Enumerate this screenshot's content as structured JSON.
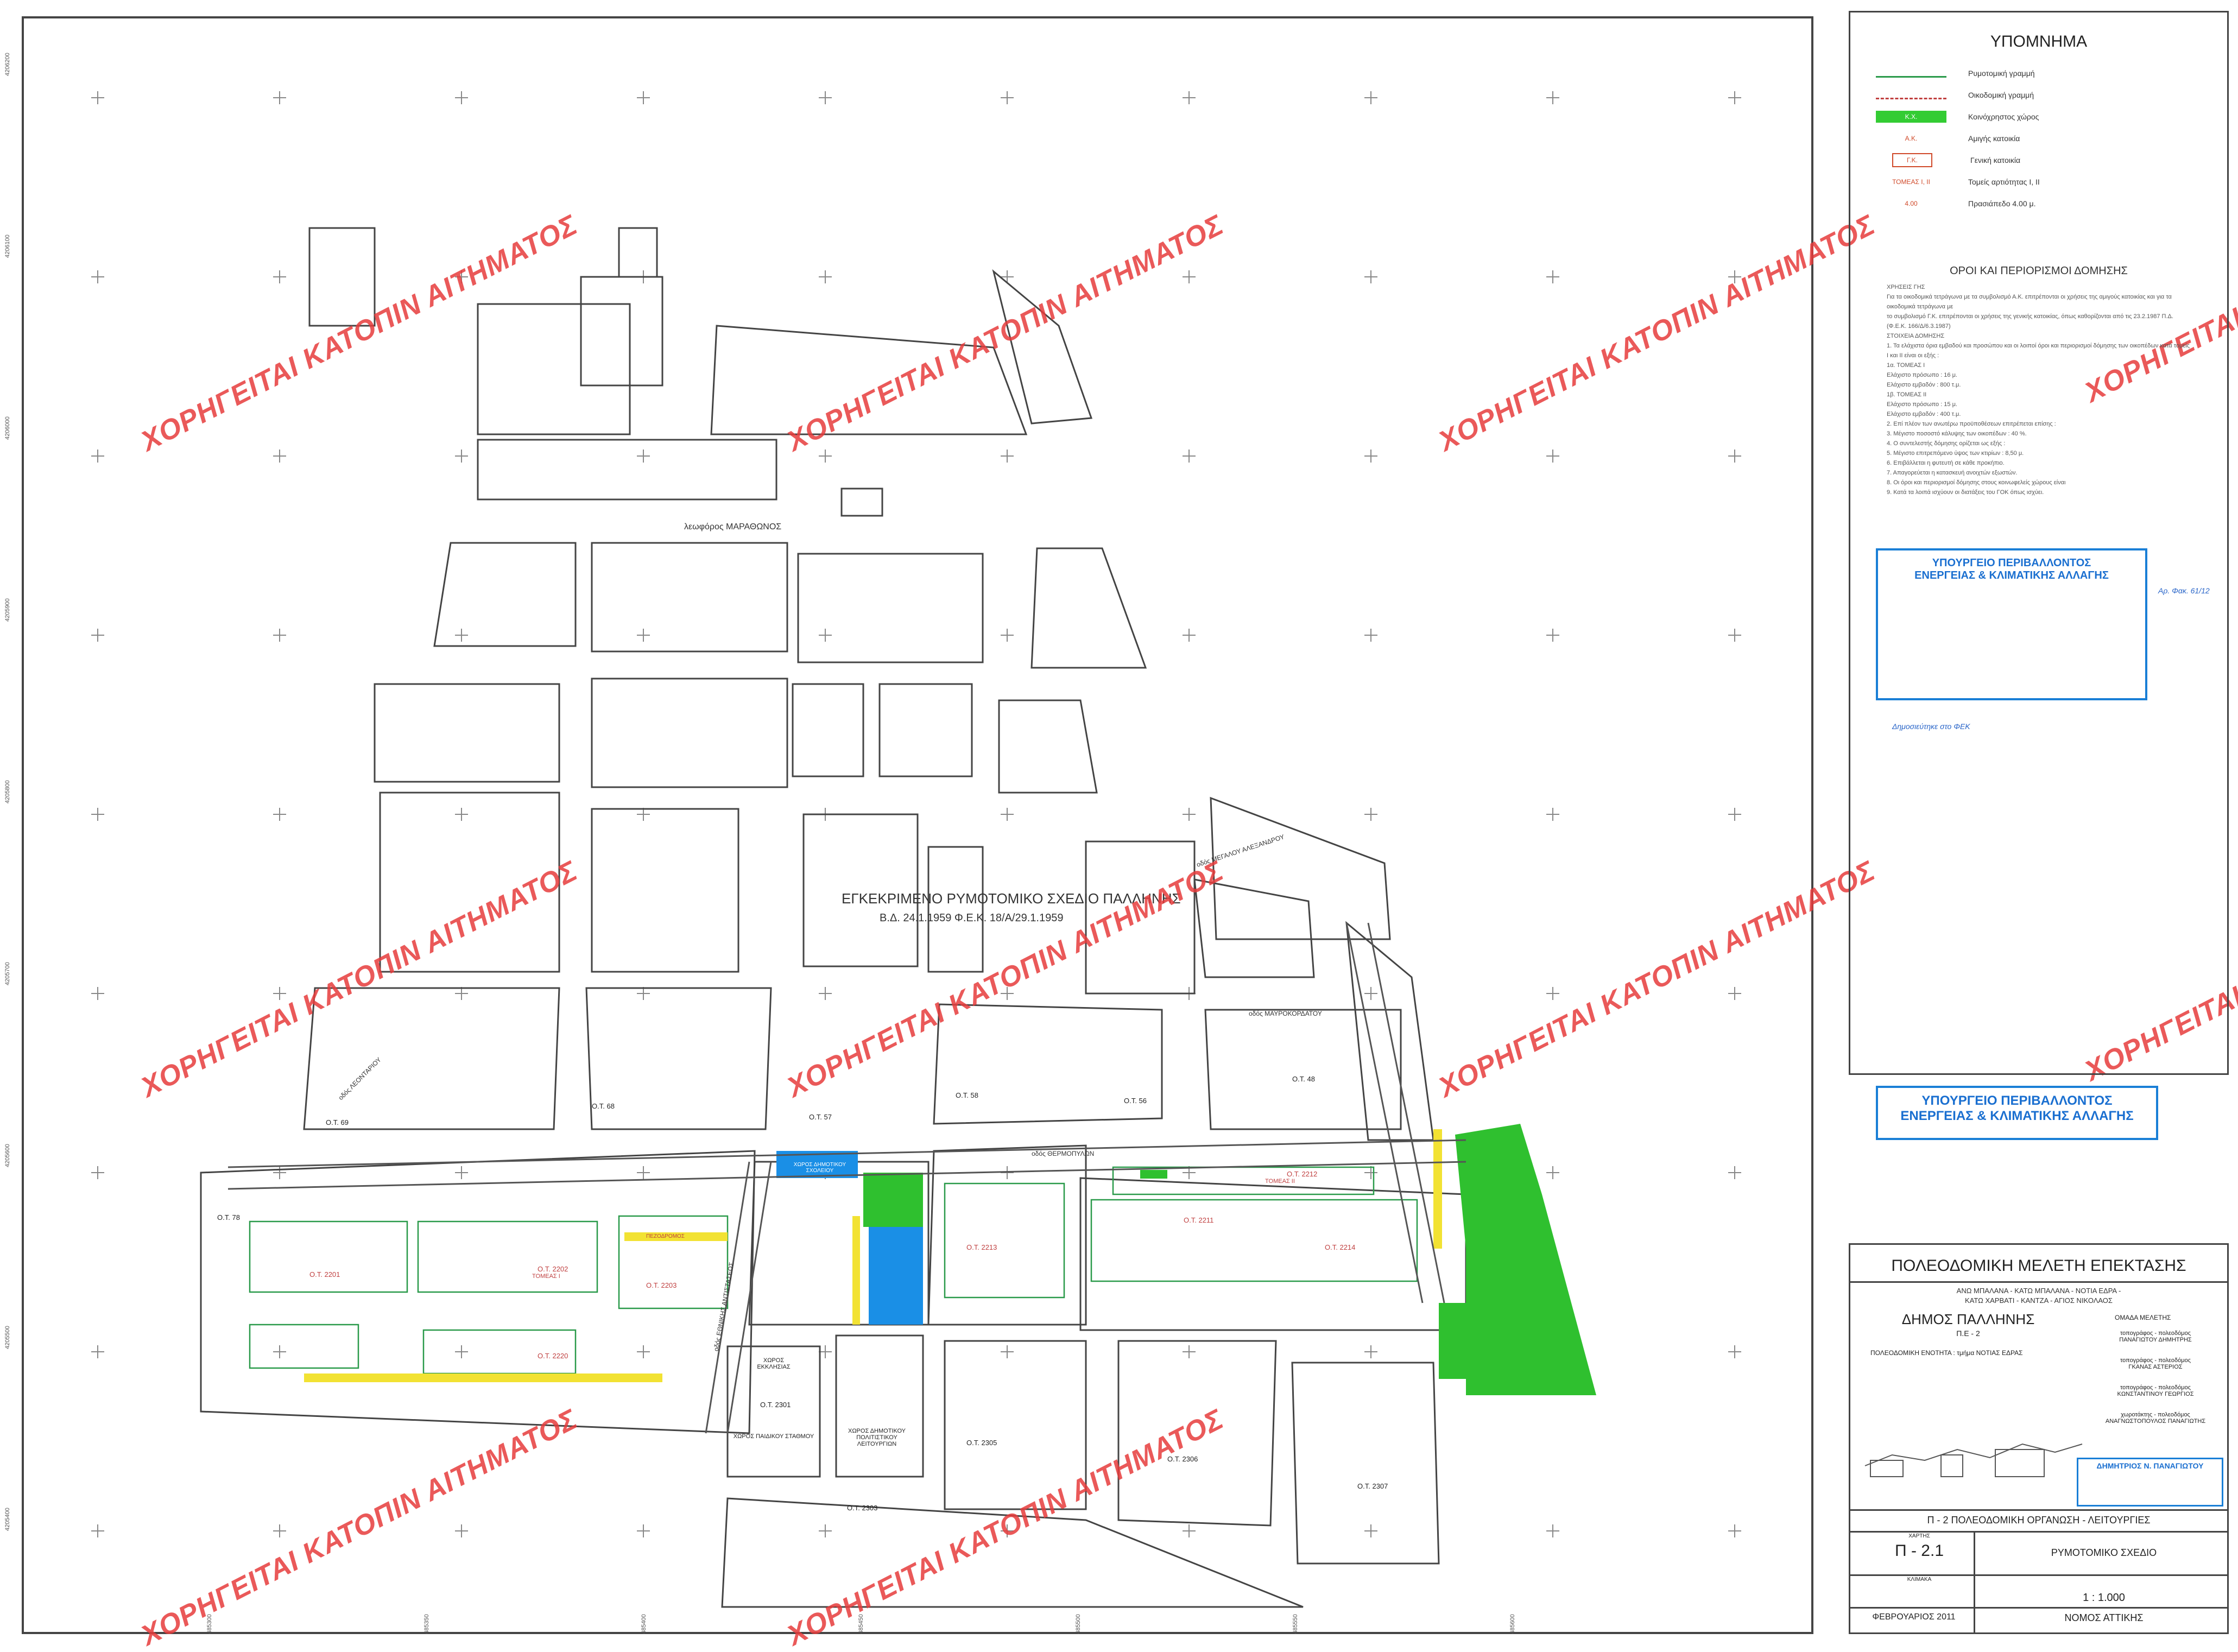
{
  "watermark": "ΧΟΡΗΓΕΙΤΑΙ ΚΑΤΟΠΙΝ ΑΙΤΗΜΑΤΟΣ",
  "map": {
    "center_title": "ΕΓΚΕΚΡΙΜΕΝΟ ΡΥΜΟΤΟΜΙΚΟ ΣΧΕΔΙΟ ΠΑΛΛΗΝΗΣ",
    "center_subtitle": "Β.Δ. 24.1.1959 Φ.Ε.Κ. 18/Α/29.1.1959",
    "avenue": "λεωφόρος ΜΑΡΑΘΩΝΟΣ",
    "streets": [
      "οδός ΜΕΓΑΛΟΥ ΑΛΕΞΑΝΔΡΟΥ",
      "οδός ΜΑΥΡΟΚΟΡΔΑΤΟΥ",
      "οδός ΘΕΡΜΟΠΥΛΩΝ",
      "οδός ΛΕΩΝΙΔΑ",
      "οδός ΕΘΝΙΚΗΣ ΑΝΤΙΣΤΑΣΕΩΣ",
      "οδός ΛΕΟΝΤΑΡΙΟΥ"
    ],
    "blocks": [
      "Ο.Τ. 69",
      "Ο.Τ. 68",
      "Ο.Τ. 57",
      "Ο.Τ. 56",
      "Ο.Τ. 58",
      "Ο.Τ. 48",
      "Ο.Τ. 78",
      "Ο.Τ. 2201",
      "Ο.Τ. 2202",
      "Ο.Τ. 2203",
      "Ο.Τ. 2220",
      "Ο.Τ. 2301",
      "Ο.Τ. 2305",
      "Ο.Τ. 2306",
      "Ο.Τ. 2307",
      "Ο.Τ. 2303",
      "Ο.Τ. 2212",
      "Ο.Τ. 2214",
      "Ο.Τ. 2213",
      "Ο.Τ. 2211"
    ],
    "places": [
      "ΧΩΡΟΣ ΕΚΚΛΗΣΙΑΣ",
      "ΧΩΡΟΣ ΠΑΙΔΙΚΟΥ ΣΤΑΘΜΟΥ",
      "ΧΩΡΟΣ ΔΗΜΟΤΙΚΟΥ ΠΟΛΙΤΙΣΤΙΚΟΥ ΛΕΙΤΟΥΡΓΙΩΝ",
      "ΧΩΡΟΣ ΔΗΜΟΤΙΚΟΥ ΣΧΟΛΕΙΟΥ"
    ],
    "zones": [
      "ΤΟΜΕΑΣ I",
      "ΤΟΜΕΑΣ II"
    ],
    "pedestrian": "ΠΕΖΟΔΡΟΜΟΣ",
    "coords_left": [
      "4206200",
      "4206100",
      "4206000",
      "4205900",
      "4205800",
      "4205700",
      "4205600",
      "4205500",
      "4205400"
    ],
    "coords_bottom": [
      "485300",
      "485350",
      "485400",
      "485450",
      "485500",
      "485550",
      "485600"
    ]
  },
  "legend": {
    "title": "ΥΠΟΜΝΗΜΑ",
    "items": [
      {
        "sym": "",
        "label": "Ρυμοτομική γραμμή",
        "color": "#2a9a4a",
        "kind": "line"
      },
      {
        "sym": "",
        "label": "Οικοδομική γραμμή",
        "color": "#c04040",
        "kind": "dash"
      },
      {
        "sym": "Κ.Χ.",
        "label": "Κοινόχρηστος χώρος",
        "color": "#33cc33",
        "kind": "fill"
      },
      {
        "sym": "Α.Κ.",
        "label": "Αμιγής κατοικία",
        "color": "#d04a2a",
        "kind": "text"
      },
      {
        "sym": "Γ.Κ.",
        "label": "Γενική κατοικία",
        "color": "#d04a2a",
        "kind": "box"
      },
      {
        "sym": "ΤΟΜΕΑΣ I, II",
        "label": "Τομείς αρτιότητας I, II",
        "color": "#d04a2a",
        "kind": "text"
      },
      {
        "sym": "4.00",
        "label": "Πρασιάπεδο 4.00 μ.",
        "color": "#d04a2a",
        "kind": "text"
      }
    ]
  },
  "terms": {
    "title": "ΟΡΟΙ ΚΑΙ ΠΕΡΙΟΡΙΣΜΟΙ ΔΟΜΗΣΗΣ",
    "lines": [
      "ΧΡΗΣΕΙΣ ΓΗΣ",
      "Για τα οικοδομικά τετράγωνα με τα συμβολισμό Α.Κ. επιτρέπονται οι χρήσεις της αμιγούς κατοικίας και για τα οικοδομικά τετράγωνα με",
      "το συμβολισμό Γ.Κ. επιτρέπονται οι χρήσεις της γενικής κατοικίας, όπως καθορίζονται από τις 23.2.1987 Π.Δ. (Φ.Ε.Κ. 166/Δ/6.3.1987)",
      "ΣΤΟΙΧΕΙΑ ΔΟΜΗΣΗΣ",
      "1. Τα ελάχιστα όρια εμβαδού και προσώπου και οι λοιποί όροι και περιορισμοί δόμησης των οικοπέδων κατά τομείς Ι και ΙΙ είναι οι εξής :",
      "1α. ΤΟΜΕΑΣ Ι",
      "Ελάχιστο πρόσωπο : 16 μ.",
      "Ελάχιστο εμβαδόν : 800 τ.μ.",
      "1β. ΤΟΜΕΑΣ ΙΙ",
      "Ελάχιστο πρόσωπο : 15 μ.",
      "Ελάχιστο εμβαδόν : 400 τ.μ.",
      "2. Επί πλέον των ανωτέρω προϋποθέσεων επιτρέπεται επίσης :",
      "3. Μέγιστο ποσοστό κάλυψης των οικοπέδων : 40 %.",
      "4. Ο συντελεστής δόμησης ορίζεται ως εξής :",
      "5. Μέγιστο επιτρεπόμενο ύψος των κτιρίων : 8,50 μ.",
      "6. Επιβάλλεται η φυτευτή σε κάθε προκήπιο.",
      "7. Απαγορεύεται η κατασκευή ανοιχτών εξωστών.",
      "8. Οι όροι και περιορισμοί δόμησης στους κοινωφελείς χώρους είναι",
      "9. Κατά τα λοιπά ισχύουν οι διατάξεις του ΓΟΚ όπως ισχύει."
    ]
  },
  "approval": {
    "ministry_line1": "ΥΠΟΥΡΓΕΙΟ ΠΕΡΙΒΑΛΛΟΝΤΟΣ",
    "ministry_line2": "ΕΝΕΡΓΕΙΑΣ & ΚΛΙΜΑΤΙΚΗΣ ΑΛΛΑΓΗΣ",
    "fek_note": "Δημοσιεύτηκε στο ΦΕΚ",
    "side_note": "Αρ. Φακ. 61/12"
  },
  "titleblock": {
    "title": "ΠΟΛΕΟΔΟΜΙΚΗ ΜΕΛΕΤΗ ΕΠΕΚΤΑΣΗΣ",
    "area1": "ΑΝΩ ΜΠΑΛΑΝΑ - ΚΑΤΩ ΜΠΑΛΑΝΑ - ΝΟΤΙΑ ΕΔΡΑ -",
    "area2": "ΚΑΤΩ ΧΑΡΒΑΤΙ - ΚΑΝΤΖΑ - ΑΓΙΟΣ ΝΙΚΟΛΑΟΣ",
    "municipality": "ΔΗΜΟΣ ΠΑΛΛΗΝΗΣ",
    "pe": "Π.Ε - 2",
    "unit": "ΠΟΛΕΟΔΟΜΙΚΗ ΕΝΟΤΗΤΑ : τμήμα ΝΟΤΙΑΣ ΕΔΡΑΣ",
    "team_title": "ΟΜΑΔΑ ΜΕΛΕΤΗΣ",
    "team": [
      {
        "role": "τοπογράφος - πολεοδόμος",
        "name": "ΠΑΝΑΓΙΩΤΟΥ ΔΗΜΗΤΡΗΣ"
      },
      {
        "role": "τοπογράφος - πολεοδόμος",
        "name": "ΓΚΑΝΑΣ ΑΣΤΕΡΙΟΣ"
      },
      {
        "role": "τοπογράφος - πολεοδόμος",
        "name": "ΚΩΝΣΤΑΝΤΙΝΟΥ ΓΕΩΡΓΙΟΣ"
      },
      {
        "role": "χωροτάκτης - πολεοδόμος",
        "name": "ΑΝΑΓΝΩΣΤΟΠΟΥΛΟΣ ΠΑΝΑΓΙΩΤΗΣ"
      }
    ],
    "signer_stamp": "ΔΗΜΗΤΡΙΟΣ Ν. ΠΑΝΑΓΙΩΤΟΥ",
    "section": "Π - 2 ΠΟΛΕΟΔΟΜΙΚΗ ΟΡΓΑΝΩΣΗ - ΛΕΙΤΟΥΡΓΙΕΣ",
    "map_label": "ΧΑΡΤΗΣ",
    "map_no": "Π - 2.1",
    "map_title": "ΡΥΜΟΤΟΜΙΚΟ ΣΧΕΔΙΟ",
    "scale_label": "ΚΛΙΜΑΚΑ",
    "scale": "1 : 1.000",
    "date": "ΦΕΒΡΟΥΑΡΙΟΣ 2011",
    "prefecture": "ΝΟΜΟΣ ΑΤΤΙΚΗΣ"
  },
  "colors": {
    "green_area": "#2fc02f",
    "blue_area": "#1a8fe6",
    "yellow_strip": "#f2e233",
    "road_line": "#555555",
    "watermark": "#e63c3c"
  }
}
